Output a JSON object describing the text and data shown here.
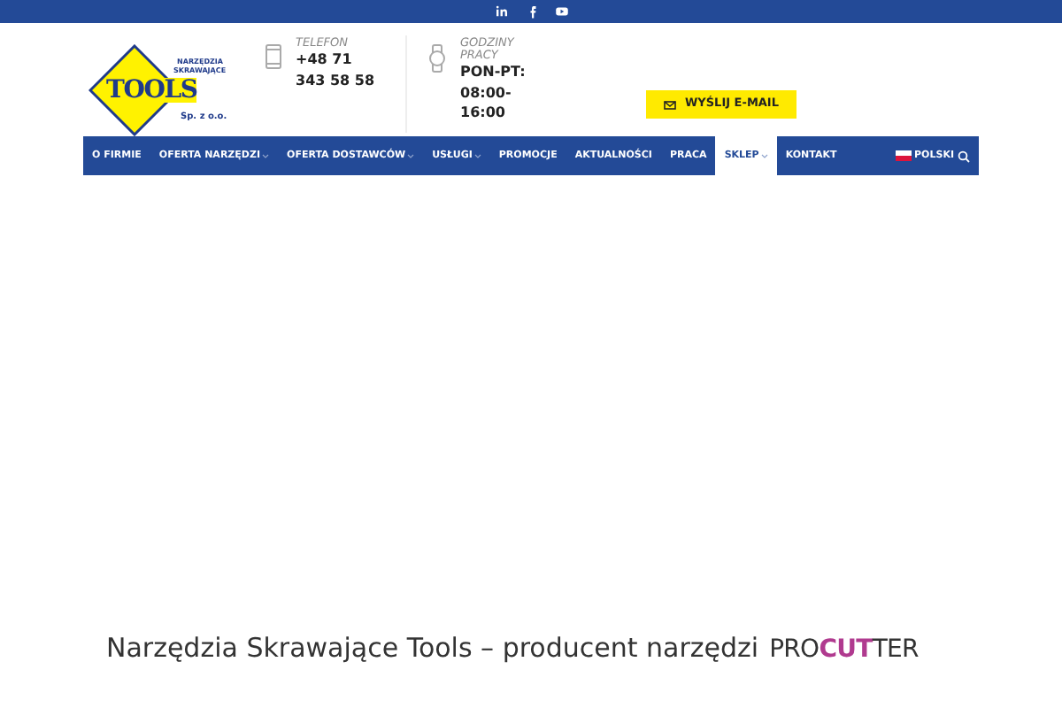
{
  "top_bar": {
    "social": [
      {
        "kind": "linkedin"
      },
      {
        "kind": "facebook"
      },
      {
        "kind": "youtube"
      }
    ]
  },
  "logo": {
    "top": "NARZĘDZIA SKRAWAJĄCE",
    "main": "TOOLS",
    "bottom": "Sp. z o.o."
  },
  "contacts": [
    {
      "kind": "phone",
      "label": "TELEFON",
      "lines": [
        "+48 71",
        "343 58 58"
      ]
    },
    {
      "kind": "clock",
      "label": "GODZINY PRACY",
      "lines": [
        "PON-PT:",
        "08:00-",
        "16:00"
      ]
    }
  ],
  "email_button": "WYŚLIJ E-MAIL",
  "nav": [
    {
      "label": "O FIRMIE",
      "dropdown": false,
      "selected": false
    },
    {
      "label": "OFERTA NARZĘDZI",
      "dropdown": true,
      "selected": false
    },
    {
      "label": "OFERTA DOSTAWCÓW",
      "dropdown": true,
      "selected": false
    },
    {
      "label": "USŁUGI",
      "dropdown": true,
      "selected": false
    },
    {
      "label": "PROMOCJE",
      "dropdown": false,
      "selected": false
    },
    {
      "label": "AKTUALNOŚCI",
      "dropdown": false,
      "selected": false
    },
    {
      "label": "PRACA",
      "dropdown": false,
      "selected": false
    },
    {
      "label": "SKLEP",
      "dropdown": true,
      "selected": true
    },
    {
      "label": "KONTAKT",
      "dropdown": false,
      "selected": false
    }
  ],
  "language": "POLSKI",
  "heading": "Narzędzia Skrawające Tools – producent narzędzi",
  "brand_logo": [
    {
      "text": "PRO",
      "highlight": false
    },
    {
      "text": "CUT",
      "highlight": true
    },
    {
      "text": "TER",
      "highlight": false
    }
  ]
}
